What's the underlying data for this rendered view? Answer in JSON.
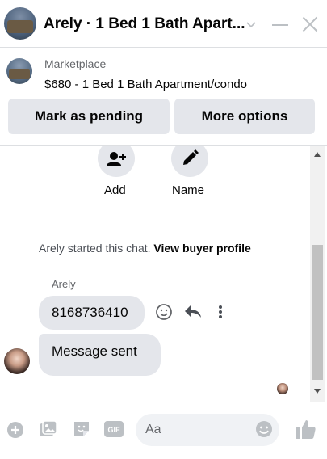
{
  "header": {
    "title": "Arely · 1 Bed 1 Bath Apart..."
  },
  "listing": {
    "source": "Marketplace",
    "title": "$680 - 1 Bed 1 Bath Apartment/condo",
    "primary_action": "Mark as pending",
    "secondary_action": "More options"
  },
  "quick_actions": [
    {
      "label": "Add",
      "icon": "add-person-icon"
    },
    {
      "label": "Name",
      "icon": "pencil-icon"
    }
  ],
  "system_message": {
    "text": "Arely started this chat. ",
    "link": "View buyer profile"
  },
  "messages": {
    "sender_name": "Arely",
    "first": "8168736410",
    "second": "Message sent"
  },
  "composer": {
    "placeholder": "Aa"
  },
  "colors": {
    "bubble": "#e4e6eb",
    "icon_gray": "#bcc0c4",
    "text": "#050505"
  }
}
